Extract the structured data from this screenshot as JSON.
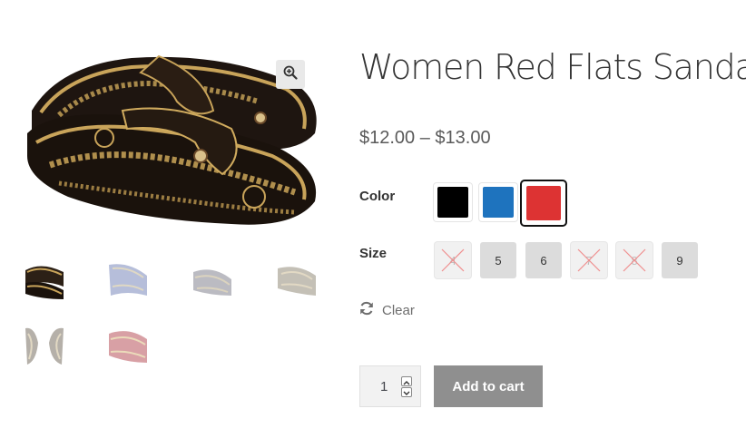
{
  "product": {
    "title": "Women Red Flats Sandal",
    "price": "$12.00 – $13.00"
  },
  "gallery": {
    "zoom_icon": "zoom-in-icon",
    "thumbnails": [
      {
        "name": "sandal-thumb-black-gold",
        "color": "#2c2016"
      },
      {
        "name": "sandal-thumb-blue",
        "color": "#6f7fb6"
      },
      {
        "name": "sandal-thumb-grey",
        "color": "#7a7a86"
      },
      {
        "name": "sandal-thumb-tan",
        "color": "#8a8270"
      },
      {
        "name": "sandal-thumb-pair",
        "color": "#6d6455"
      },
      {
        "name": "sandal-thumb-red",
        "color": "#b3434e"
      }
    ]
  },
  "attributes": {
    "color_label": "Color",
    "colors": [
      {
        "name": "black",
        "hex": "#000000",
        "selected": false
      },
      {
        "name": "blue",
        "hex": "#1e73be",
        "selected": false
      },
      {
        "name": "red",
        "hex": "#dd3333",
        "selected": true
      }
    ],
    "size_label": "Size",
    "sizes": [
      {
        "label": "4",
        "available": false
      },
      {
        "label": "5",
        "available": true
      },
      {
        "label": "6",
        "available": true
      },
      {
        "label": "7",
        "available": false
      },
      {
        "label": "8",
        "available": false
      },
      {
        "label": "9",
        "available": true
      }
    ],
    "clear_label": "Clear",
    "clear_icon": "refresh-icon"
  },
  "cart": {
    "quantity": "1",
    "add_to_cart_label": "Add to cart"
  }
}
